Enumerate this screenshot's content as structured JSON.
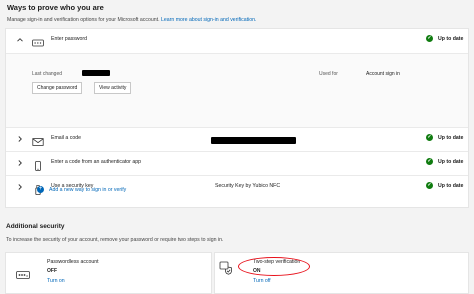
{
  "header": {
    "title": "Ways to prove who you are",
    "description": "Manage sign-in and verification options for your Microsoft account.",
    "learn_more": "Learn more about sign-in and verification."
  },
  "methods": {
    "password": {
      "label": "Enter password",
      "status": "Up to date",
      "last_changed_label": "Last changed",
      "used_for_label": "Used for",
      "used_for_value": "Account sign in",
      "change_button": "Change password",
      "activity_button": "View activity"
    },
    "email": {
      "label": "Email a code",
      "status": "Up to date"
    },
    "authenticator": {
      "label": "Enter a code from an authenticator app",
      "status": "Up to date"
    },
    "security_key": {
      "label": "Use a security key",
      "detail": "Security Key by Yubico NFC",
      "status": "Up to date"
    },
    "add_link": "Add a new way to sign in or verify"
  },
  "additional": {
    "title": "Additional security",
    "description": "To increase the security of your account, remove your password or require two steps to sign in.",
    "passwordless": {
      "name": "Passwordless account",
      "state": "OFF",
      "action": "Turn on"
    },
    "two_step": {
      "name": "Two-step verification",
      "state": "ON",
      "action": "Turn off"
    }
  },
  "colors": {
    "accent": "#0067b8",
    "success": "#107c10",
    "highlight": "#e8111b"
  },
  "icons": {
    "status": "checkmark-circle-icon",
    "password": "password-keyboard-icon",
    "email": "envelope-icon",
    "authenticator": "phone-icon",
    "security_key": "usb-key-icon",
    "add": "plus-circle-icon",
    "passwordless": "password-dots-icon",
    "two_step": "two-step-shield-icon"
  }
}
